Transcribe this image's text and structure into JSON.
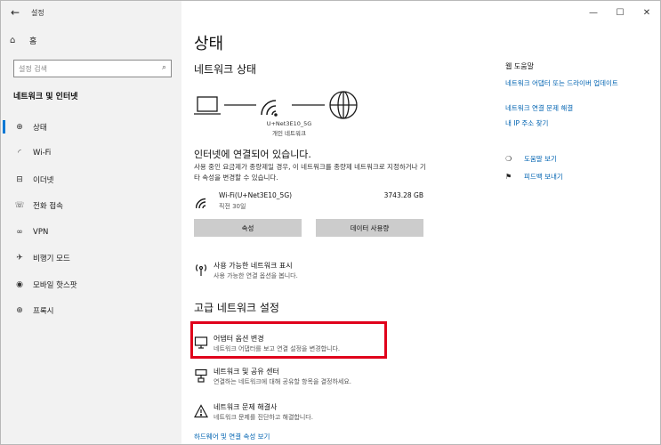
{
  "window": {
    "app_title": "설정",
    "back_glyph": "←",
    "minimize_glyph": "—",
    "maximize_glyph": "☐",
    "close_glyph": "✕"
  },
  "sidebar": {
    "home_label": "홈",
    "search_placeholder": "설정 검색",
    "section_label": "네트워크 및 인터넷",
    "items": [
      {
        "label": "상태",
        "icon": "status-globe-icon",
        "glyph": "⊕",
        "active": true
      },
      {
        "label": "Wi-Fi",
        "icon": "wifi-icon",
        "glyph": "◜",
        "active": false
      },
      {
        "label": "이더넷",
        "icon": "ethernet-icon",
        "glyph": "⊟",
        "active": false
      },
      {
        "label": "전화 접속",
        "icon": "dialup-icon",
        "glyph": "☏",
        "active": false
      },
      {
        "label": "VPN",
        "icon": "vpn-icon",
        "glyph": "∞",
        "active": false
      },
      {
        "label": "비행기 모드",
        "icon": "airplane-icon",
        "glyph": "✈",
        "active": false
      },
      {
        "label": "모바일 핫스팟",
        "icon": "hotspot-icon",
        "glyph": "◉",
        "active": false
      },
      {
        "label": "프록시",
        "icon": "proxy-globe-icon",
        "glyph": "⊕",
        "active": false
      }
    ]
  },
  "main": {
    "page_title": "상태",
    "network_status_heading": "네트워크 상태",
    "network_name": "U+Net3E10_5G",
    "network_type": "개인 네트워크",
    "connected_heading": "인터넷에 연결되어 있습니다.",
    "connected_desc": "사용 중인 요금제가 종량제일 경우, 이 네트워크를 종량제 네트워크로 지정하거나 기타 속성을 변경할 수 있습니다.",
    "wifi_entry": {
      "name": "Wi-Fi(U+Net3E10_5G)",
      "sub": "직전 30일",
      "usage": "3743.28 GB"
    },
    "buttons": {
      "properties": "속성",
      "data_usage": "데이터 사용량"
    },
    "available_networks": {
      "title": "사용 가능한 네트워크 표시",
      "desc": "사용 가능한 연결 옵션을 봅니다."
    },
    "advanced_heading": "고급 네트워크 설정",
    "adapter_options": {
      "title": "어댑터 옵션 변경",
      "desc": "네트워크 어댑터를 보고 연결 설정을 변경합니다."
    },
    "sharing_center": {
      "title": "네트워크 및 공유 센터",
      "desc": "연결하는 네트워크에 대해 공유할 항목을 결정하세요."
    },
    "troubleshooter": {
      "title": "네트워크 문제 해결사",
      "desc": "네트워크 문제를 진단하고 해결합니다."
    },
    "bottom_link": "하드웨어 및 연결 속성 보기"
  },
  "right_panel": {
    "heading": "웹 도움말",
    "links": [
      "네트워크 어댑터 또는 드라이버 업데이트",
      "네트워크 연결 문제 해결",
      "내 IP 주소 찾기"
    ],
    "help_link": "도움말 보기",
    "feedback_link": "피드백 보내기"
  },
  "colors": {
    "accent": "#0078d4",
    "link": "#0063b1",
    "highlight": "#e0001b",
    "sidebar_bg": "#f2f2f2",
    "button_bg": "#cccccc"
  }
}
